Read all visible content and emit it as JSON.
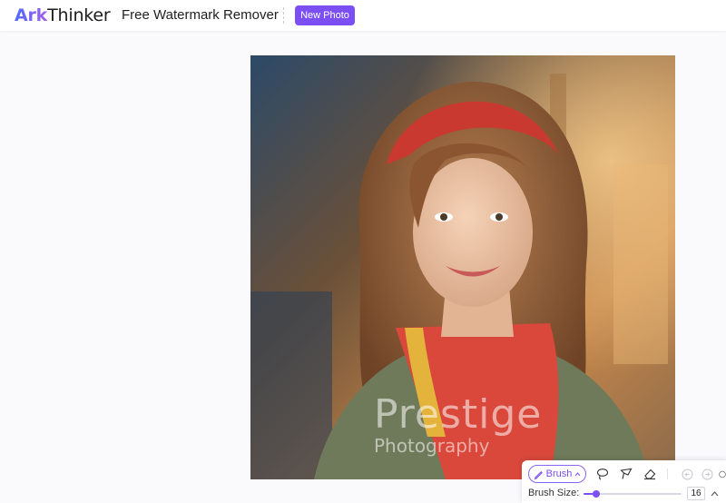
{
  "header": {
    "logo_part1": "Ark",
    "logo_part2": "Thinker",
    "title": "Free Watermark Remover",
    "new_photo_label": "New Photo"
  },
  "photo": {
    "watermark_main": "Prestige",
    "watermark_sub": "Photography"
  },
  "toolbar": {
    "brush_label": "Brush",
    "tools": [
      "lasso-icon",
      "polygon-lasso-icon",
      "eraser-icon"
    ],
    "history": [
      "undo-icon",
      "redo-icon",
      "reset-icon"
    ],
    "brush_size_label": "Brush Size:",
    "brush_size_value": "16",
    "brush_size_fraction": 0.13
  },
  "colors": {
    "accent": "#7b4ff4",
    "logo_gradient_start": "#4f6cff",
    "logo_gradient_end": "#a45cf7"
  }
}
